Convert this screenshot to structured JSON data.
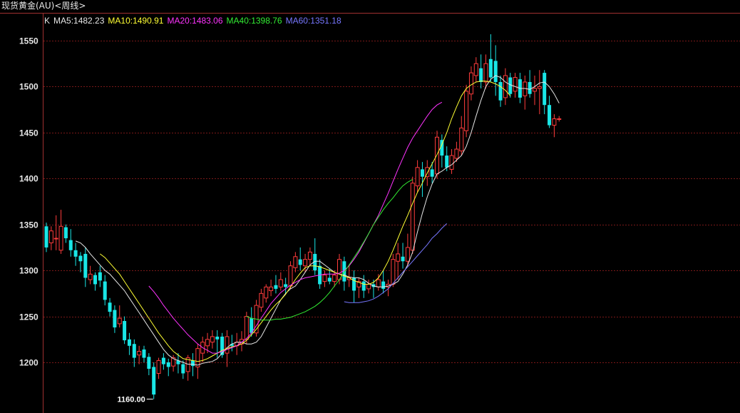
{
  "title": "现货黄金(AU)<周线>",
  "chart_data": {
    "type": "candlestick",
    "ylim": [
      1140,
      1580
    ],
    "yticks": [
      1200,
      1250,
      1300,
      1350,
      1400,
      1450,
      1500,
      1550
    ],
    "legend": [
      {
        "label": "K",
        "color": "#e6e6e6"
      },
      {
        "label": "MA5:1482.23",
        "color": "#e6e6e6"
      },
      {
        "label": "MA10:1490.91",
        "color": "#ffff33"
      },
      {
        "label": "MA20:1483.06",
        "color": "#ff33ff"
      },
      {
        "label": "MA40:1398.76",
        "color": "#33ee33"
      },
      {
        "label": "MA60:1351.18",
        "color": "#7777ff"
      }
    ],
    "annotations": {
      "high": {
        "label": "1557.10",
        "value": 1557.1
      },
      "low": {
        "label": "1160.00",
        "value": 1160.0
      }
    },
    "candles": [
      [
        1348,
        1325,
        1352,
        1320
      ],
      [
        1330,
        1343,
        1348,
        1322
      ],
      [
        1335,
        1335,
        1360,
        1322
      ],
      [
        1322,
        1348,
        1366,
        1318
      ],
      [
        1347,
        1335,
        1350,
        1330
      ],
      [
        1333,
        1322,
        1345,
        1315
      ],
      [
        1322,
        1315,
        1330,
        1305
      ],
      [
        1316,
        1310,
        1320,
        1298
      ],
      [
        1318,
        1292,
        1325,
        1282
      ],
      [
        1290,
        1296,
        1305,
        1285
      ],
      [
        1295,
        1285,
        1298,
        1278
      ],
      [
        1298,
        1289,
        1305,
        1282
      ],
      [
        1288,
        1268,
        1295,
        1262
      ],
      [
        1265,
        1255,
        1270,
        1250
      ],
      [
        1257,
        1238,
        1262,
        1232
      ],
      [
        1242,
        1248,
        1262,
        1238
      ],
      [
        1245,
        1224,
        1250,
        1220
      ],
      [
        1225,
        1218,
        1232,
        1208
      ],
      [
        1220,
        1205,
        1225,
        1195
      ],
      [
        1208,
        1212,
        1218,
        1198
      ],
      [
        1214,
        1205,
        1218,
        1200
      ],
      [
        1206,
        1193,
        1210,
        1186
      ],
      [
        1195,
        1165,
        1200,
        1160
      ],
      [
        1188,
        1202,
        1205,
        1182
      ],
      [
        1205,
        1198,
        1210,
        1192
      ],
      [
        1200,
        1195,
        1204,
        1185
      ],
      [
        1196,
        1205,
        1208,
        1190
      ],
      [
        1202,
        1198,
        1210,
        1188
      ],
      [
        1198,
        1188,
        1202,
        1182
      ],
      [
        1190,
        1205,
        1208,
        1180
      ],
      [
        1202,
        1196,
        1210,
        1185
      ],
      [
        1195,
        1215,
        1220,
        1182
      ],
      [
        1210,
        1222,
        1228,
        1200
      ],
      [
        1218,
        1225,
        1232,
        1210
      ],
      [
        1222,
        1228,
        1235,
        1215
      ],
      [
        1228,
        1225,
        1235,
        1205
      ],
      [
        1228,
        1208,
        1232,
        1205
      ],
      [
        1210,
        1228,
        1235,
        1195
      ],
      [
        1220,
        1218,
        1230,
        1212
      ],
      [
        1218,
        1222,
        1232,
        1208
      ],
      [
        1220,
        1225,
        1234,
        1212
      ],
      [
        1225,
        1250,
        1255,
        1220
      ],
      [
        1248,
        1232,
        1260,
        1228
      ],
      [
        1232,
        1262,
        1268,
        1228
      ],
      [
        1260,
        1275,
        1280,
        1255
      ],
      [
        1270,
        1282,
        1285,
        1265
      ],
      [
        1278,
        1282,
        1290,
        1272
      ],
      [
        1284,
        1280,
        1295,
        1275
      ],
      [
        1282,
        1290,
        1298,
        1278
      ],
      [
        1285,
        1282,
        1292,
        1275
      ],
      [
        1283,
        1305,
        1310,
        1280
      ],
      [
        1303,
        1315,
        1320,
        1298
      ],
      [
        1312,
        1306,
        1325,
        1300
      ],
      [
        1305,
        1312,
        1318,
        1298
      ],
      [
        1312,
        1320,
        1325,
        1305
      ],
      [
        1318,
        1300,
        1335,
        1295
      ],
      [
        1305,
        1285,
        1312,
        1280
      ],
      [
        1288,
        1295,
        1300,
        1282
      ],
      [
        1292,
        1288,
        1302,
        1285
      ],
      [
        1288,
        1295,
        1300,
        1282
      ],
      [
        1290,
        1312,
        1318,
        1285
      ],
      [
        1310,
        1288,
        1315,
        1278
      ],
      [
        1290,
        1292,
        1305,
        1282
      ],
      [
        1292,
        1278,
        1300,
        1265
      ],
      [
        1282,
        1288,
        1292,
        1270
      ],
      [
        1288,
        1278,
        1295,
        1270
      ],
      [
        1280,
        1285,
        1290,
        1275
      ],
      [
        1285,
        1282,
        1290,
        1270
      ],
      [
        1282,
        1290,
        1296,
        1278
      ],
      [
        1288,
        1280,
        1300,
        1275
      ],
      [
        1282,
        1285,
        1290,
        1272
      ],
      [
        1285,
        1312,
        1318,
        1282
      ],
      [
        1310,
        1318,
        1330,
        1290
      ],
      [
        1315,
        1310,
        1330,
        1302
      ],
      [
        1310,
        1325,
        1340,
        1305
      ],
      [
        1322,
        1395,
        1402,
        1318
      ],
      [
        1392,
        1412,
        1420,
        1385
      ],
      [
        1410,
        1402,
        1418,
        1380
      ],
      [
        1402,
        1412,
        1420,
        1392
      ],
      [
        1410,
        1402,
        1418,
        1395
      ],
      [
        1405,
        1445,
        1452,
        1400
      ],
      [
        1442,
        1425,
        1448,
        1412
      ],
      [
        1425,
        1412,
        1435,
        1408
      ],
      [
        1410,
        1425,
        1432,
        1405
      ],
      [
        1422,
        1432,
        1440,
        1418
      ],
      [
        1430,
        1455,
        1468,
        1425
      ],
      [
        1452,
        1495,
        1502,
        1445
      ],
      [
        1492,
        1515,
        1522,
        1485
      ],
      [
        1512,
        1525,
        1532,
        1505
      ],
      [
        1520,
        1505,
        1535,
        1498
      ],
      [
        1505,
        1525,
        1535,
        1498
      ],
      [
        1530,
        1510,
        1557,
        1505
      ],
      [
        1528,
        1505,
        1545,
        1490
      ],
      [
        1505,
        1485,
        1512,
        1478
      ],
      [
        1488,
        1512,
        1520,
        1480
      ],
      [
        1510,
        1492,
        1515,
        1488
      ],
      [
        1495,
        1510,
        1515,
        1488
      ],
      [
        1508,
        1488,
        1515,
        1482
      ],
      [
        1490,
        1505,
        1512,
        1475
      ],
      [
        1505,
        1492,
        1518,
        1488
      ],
      [
        1495,
        1498,
        1512,
        1480
      ],
      [
        1498,
        1500,
        1518,
        1470
      ],
      [
        1515,
        1480,
        1518,
        1470
      ],
      [
        1480,
        1458,
        1490,
        1455
      ],
      [
        1458,
        1465,
        1470,
        1445
      ],
      [
        1465,
        1465,
        1468,
        1462
      ]
    ],
    "ma": [
      {
        "name": "MA5",
        "color": "#e6e6e6",
        "start": 6,
        "values": [
          1332,
          1330,
          1325,
          1318,
          1312,
          1306,
          1300,
          1296,
          1290,
          1284,
          1278,
          1270,
          1262,
          1254,
          1246,
          1238,
          1230,
          1222,
          1214,
          1208,
          1204,
          1202,
          1200,
          1198,
          1198,
          1197,
          1199,
          1200,
          1201,
          1204,
          1210,
          1216,
          1220,
          1222,
          1222,
          1220,
          1220,
          1222,
          1228,
          1238,
          1248,
          1258,
          1268,
          1275,
          1280,
          1283,
          1290,
          1298,
          1306,
          1310,
          1310,
          1306,
          1302,
          1298,
          1296,
          1295,
          1293,
          1292,
          1292,
          1290,
          1286,
          1283,
          1282,
          1282,
          1283,
          1285,
          1288,
          1296,
          1306,
          1320,
          1342,
          1362,
          1380,
          1394,
          1405,
          1408,
          1412,
          1415,
          1420,
          1425,
          1435,
          1450,
          1468,
          1485,
          1500,
          1508,
          1512,
          1510,
          1505,
          1502,
          1500,
          1498,
          1498,
          1497,
          1500,
          1504,
          1505,
          1500,
          1492,
          1482
        ]
      },
      {
        "name": "MA10",
        "color": "#ffff33",
        "start": 11,
        "values": [
          1318,
          1314,
          1308,
          1302,
          1296,
          1288,
          1280,
          1272,
          1264,
          1256,
          1248,
          1240,
          1232,
          1225,
          1218,
          1212,
          1208,
          1204,
          1203,
          1202,
          1201,
          1202,
          1204,
          1207,
          1210,
          1213,
          1215,
          1217,
          1218,
          1220,
          1224,
          1230,
          1236,
          1243,
          1250,
          1257,
          1263,
          1268,
          1274,
          1282,
          1290,
          1297,
          1303,
          1305,
          1305,
          1304,
          1302,
          1300,
          1298,
          1296,
          1294,
          1292,
          1289,
          1287,
          1285,
          1285,
          1287,
          1292,
          1300,
          1310,
          1322,
          1335,
          1348,
          1360,
          1373,
          1385,
          1395,
          1406,
          1416,
          1426,
          1437,
          1450,
          1465,
          1478,
          1490,
          1498,
          1502,
          1505,
          1506,
          1506,
          1505,
          1503,
          1500,
          1496,
          1490
        ]
      },
      {
        "name": "MA20",
        "color": "#ff33ff",
        "start": 21,
        "values": [
          1283,
          1277,
          1270,
          1262,
          1255,
          1248,
          1242,
          1236,
          1230,
          1225,
          1220,
          1216,
          1213,
          1210,
          1210,
          1212,
          1214,
          1216,
          1218,
          1222,
          1226,
          1232,
          1240,
          1248,
          1256,
          1264,
          1270,
          1276,
          1280,
          1284,
          1287,
          1290,
          1292,
          1293,
          1294,
          1295,
          1296,
          1296,
          1296,
          1297,
          1300,
          1305,
          1312,
          1320,
          1330,
          1340,
          1350,
          1360,
          1372,
          1384,
          1397,
          1410,
          1422,
          1434,
          1444,
          1452,
          1460,
          1468,
          1475,
          1480,
          1483
        ]
      },
      {
        "name": "MA40",
        "color": "#33ee33",
        "start": 41,
        "values": [
          1250,
          1248,
          1247,
          1246,
          1246,
          1246,
          1247,
          1247,
          1248,
          1249,
          1251,
          1253,
          1255,
          1258,
          1261,
          1265,
          1270,
          1276,
          1283,
          1290,
          1298,
          1306,
          1314,
          1322,
          1331,
          1340,
          1350,
          1358,
          1366,
          1373,
          1379,
          1386,
          1392,
          1396,
          1399
        ]
      },
      {
        "name": "MA60",
        "color": "#7777ff",
        "start": 61,
        "values": [
          1266,
          1265,
          1265,
          1265,
          1266,
          1267,
          1269,
          1272,
          1276,
          1280,
          1286,
          1292,
          1298,
          1304,
          1310,
          1316,
          1322,
          1328,
          1335,
          1340,
          1346,
          1351
        ]
      }
    ]
  }
}
